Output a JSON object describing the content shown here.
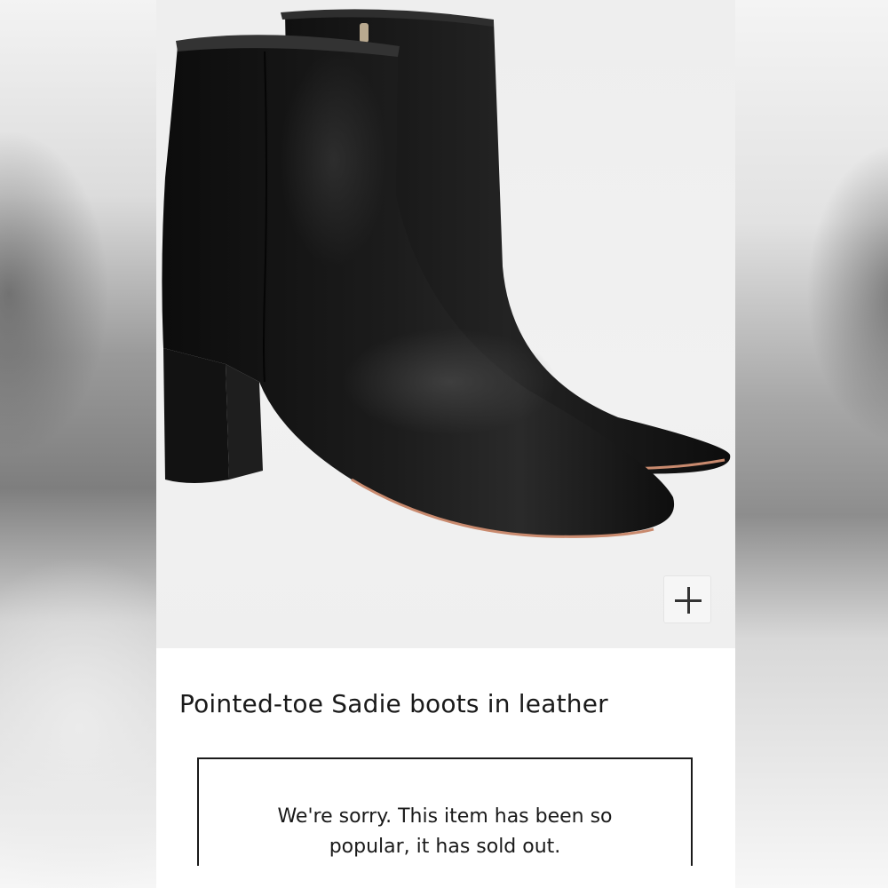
{
  "product": {
    "title": "Pointed-toe Sadie boots in leather",
    "image_alt": "Black leather pointed-toe ankle boots with block heel",
    "zoom_icon": "plus-icon"
  },
  "availability": {
    "message_line1": "We're sorry. This item has been so",
    "message_line2": "popular, it has sold out."
  },
  "colors": {
    "image_background": "#efefef",
    "boot_leather": "#141414",
    "text": "#1a1a1a",
    "box_border": "#1a1a1a"
  }
}
